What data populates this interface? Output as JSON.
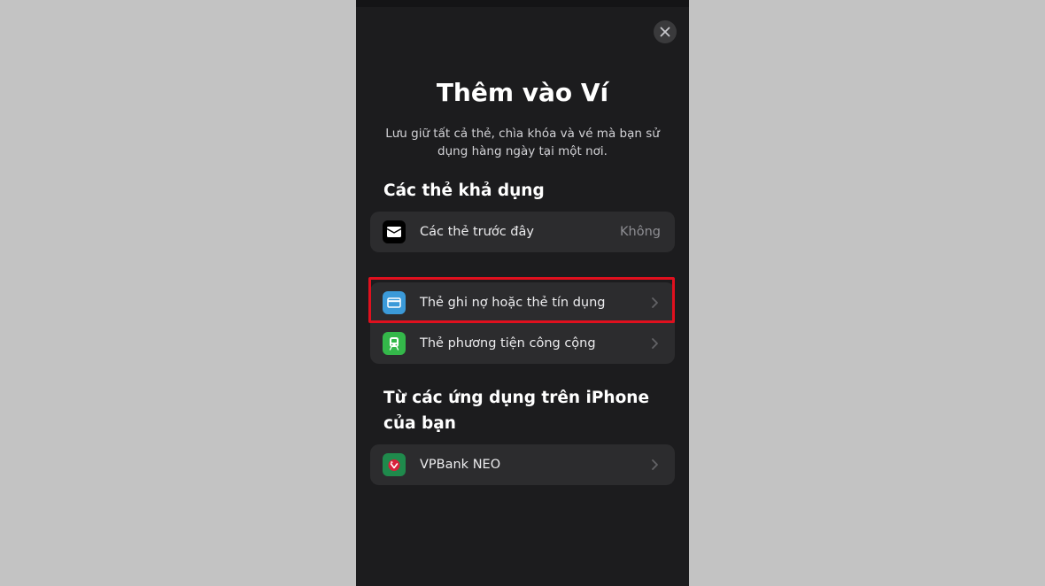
{
  "sheet": {
    "title": "Thêm vào Ví",
    "subtitle": "Lưu giữ tất cả thẻ, chìa khóa và vé mà bạn sử dụng hàng ngày tại một nơi."
  },
  "available_cards": {
    "heading": "Các thẻ khả dụng",
    "previous_cards": {
      "label": "Các thẻ trước đây",
      "value": "Không",
      "icon": "wallet-icon"
    }
  },
  "add_options": {
    "items": [
      {
        "label": "Thẻ ghi nợ hoặc thẻ tín dụng",
        "icon": "credit-card-icon",
        "icon_color": "#3b9ad9"
      },
      {
        "label": "Thẻ phương tiện công cộng",
        "icon": "train-icon",
        "icon_color": "#34b84a"
      }
    ]
  },
  "from_apps": {
    "heading": "Từ các ứng dụng trên iPhone của bạn",
    "apps": [
      {
        "label": "VPBank NEO",
        "icon": "vpbank-neo-app-icon"
      }
    ]
  },
  "colors": {
    "highlight": "#e0101e",
    "background": "#1c1c1e",
    "row_background": "#2c2c2e"
  }
}
